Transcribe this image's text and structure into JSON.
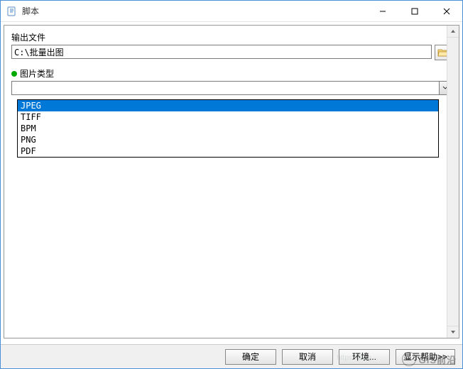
{
  "window": {
    "title": "脚本"
  },
  "fields": {
    "output_file": {
      "label": "输出文件",
      "value": "C:\\批量出图"
    },
    "image_type": {
      "label": "图片类型",
      "value": ""
    }
  },
  "dropdown": {
    "options": [
      "JPEG",
      "TIFF",
      "BPM",
      "PNG",
      "PDF"
    ],
    "selected_index": 0
  },
  "buttons": {
    "ok": "确定",
    "cancel": "取消",
    "env": "环境...",
    "help": "显示帮助>>"
  },
  "watermark": {
    "text": "GIS前沿"
  }
}
